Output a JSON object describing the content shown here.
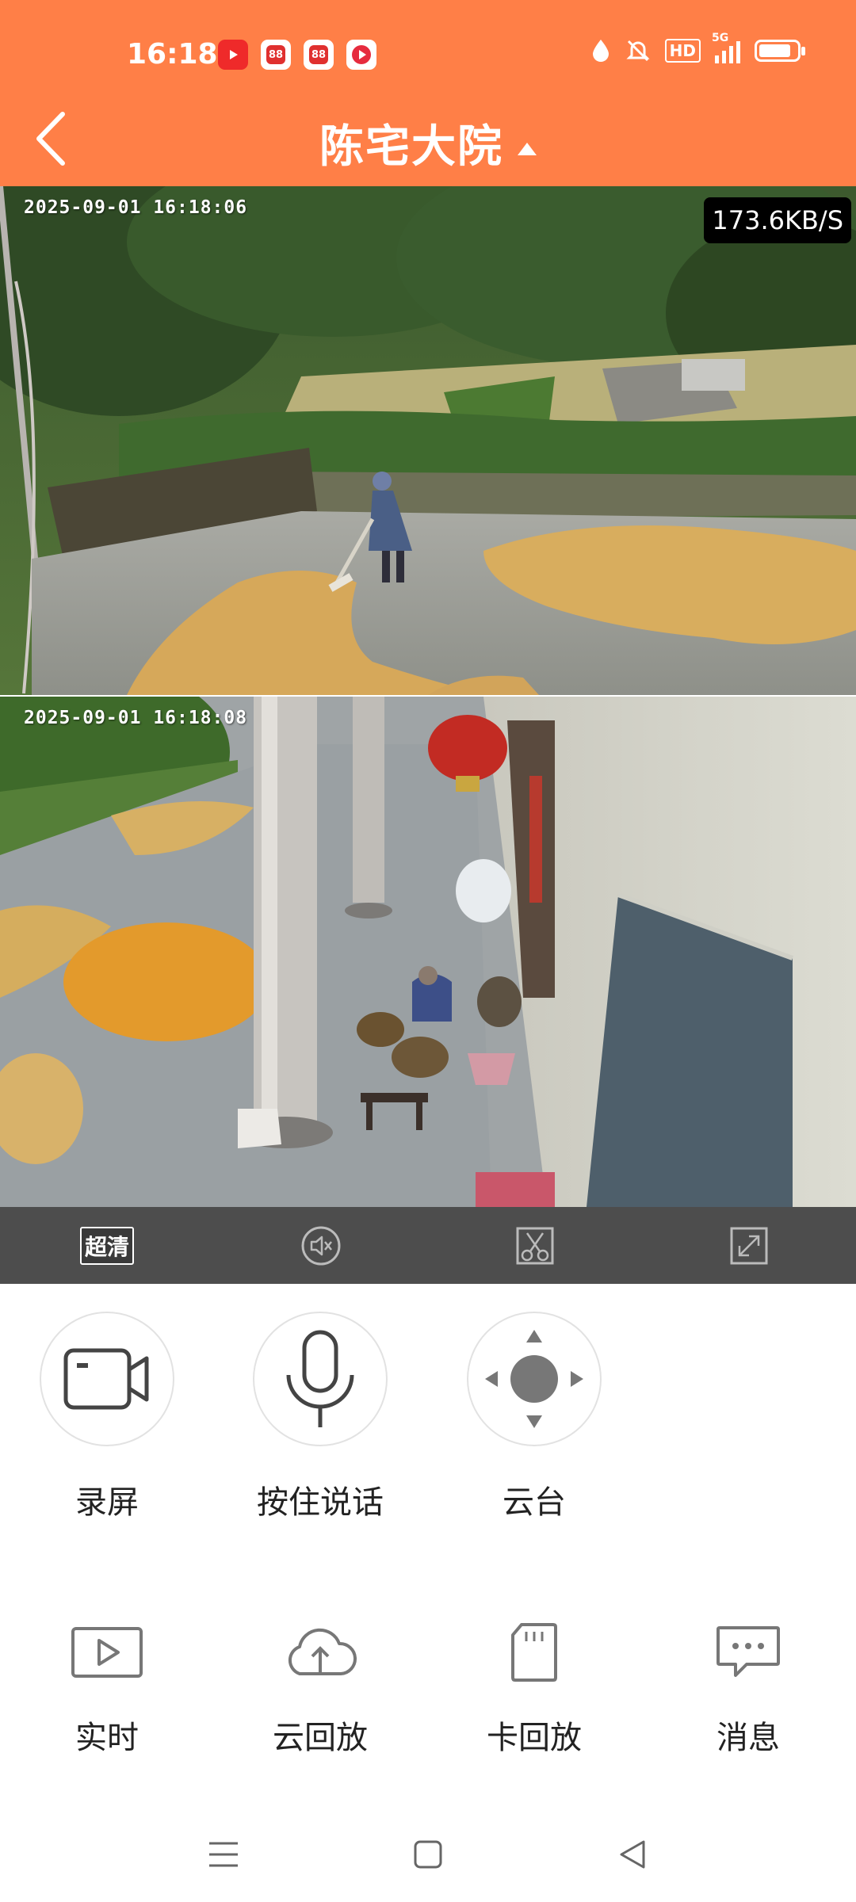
{
  "status_bar": {
    "time": "16:18",
    "app_icons": [
      "video-app-icon",
      "shop-app-icon",
      "shop-app-icon-2",
      "video-app-icon-2"
    ],
    "hd_label": "HD",
    "network_label": "5G",
    "battery_level": 0.85
  },
  "header": {
    "title": "陈宅大院",
    "background_color": "#ff7f47"
  },
  "feeds": [
    {
      "timestamp": "2025-09-01 16:18:06",
      "bitrate": "173.6KB/S"
    },
    {
      "timestamp": "2025-09-01 16:18:08"
    }
  ],
  "control_bar": {
    "quality_label": "超清",
    "icons": [
      "mute-icon",
      "split-screen-icon",
      "fullscreen-icon"
    ]
  },
  "functions": [
    {
      "label": "录屏",
      "icon": "video-camera-icon"
    },
    {
      "label": "按住说话",
      "icon": "microphone-icon"
    },
    {
      "label": "云台",
      "icon": "ptz-joystick-icon"
    }
  ],
  "playback": [
    {
      "label": "实时",
      "icon": "play-icon"
    },
    {
      "label": "云回放",
      "icon": "cloud-upload-icon"
    },
    {
      "label": "卡回放",
      "icon": "sd-card-icon"
    },
    {
      "label": "消息",
      "icon": "message-icon"
    }
  ],
  "system_nav": [
    "menu-icon",
    "home-icon",
    "back-triangle-icon"
  ]
}
